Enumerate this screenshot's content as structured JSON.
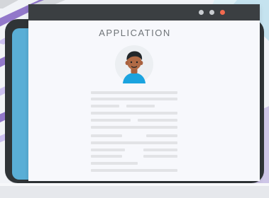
{
  "app": {
    "title": "APPLICATION"
  },
  "icons": {
    "window_controls": [
      "window-dot-gray-icon",
      "window-dot-gray-icon",
      "window-dot-red-icon"
    ],
    "profile_avatar": "person-avatar-icon"
  },
  "colors": {
    "laptop_frame": "#2f3437",
    "screen": "#5aaed6",
    "window_bg": "#f7f8fc",
    "titlebar": "#3b3f42",
    "accent_close": "#f26a4f",
    "text_muted": "#6f7478",
    "line_placeholder": "#e2e3e6"
  }
}
